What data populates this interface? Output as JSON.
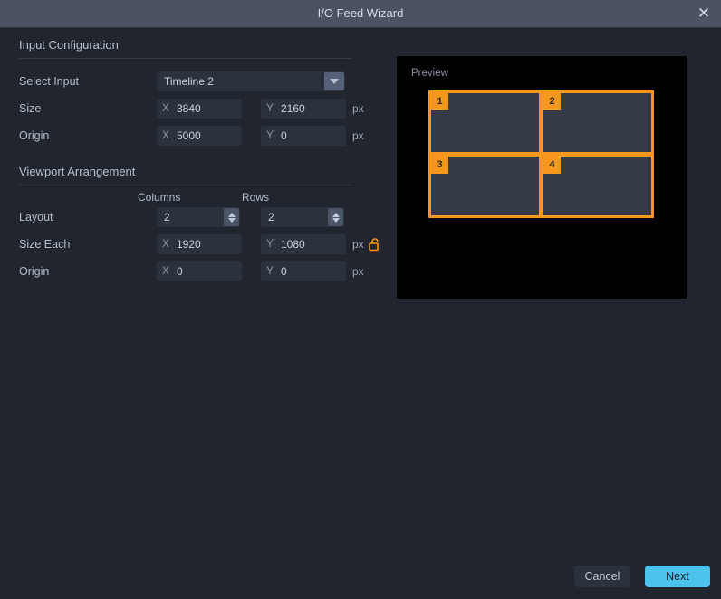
{
  "window": {
    "title": "I/O Feed Wizard",
    "close_icon": "close-icon"
  },
  "input_configuration": {
    "heading": "Input Configuration",
    "select_input": {
      "label": "Select Input",
      "value": "Timeline 2",
      "arrow_icon": "chevron-down-icon"
    },
    "size": {
      "label": "Size",
      "x_axis": "X",
      "x_value": "3840",
      "y_axis": "Y",
      "y_value": "2160",
      "unit": "px"
    },
    "origin": {
      "label": "Origin",
      "x_axis": "X",
      "x_value": "5000",
      "y_axis": "Y",
      "y_value": "0",
      "unit": "px"
    }
  },
  "viewport_arrangement": {
    "heading": "Viewport Arrangement",
    "columns_header": "Columns",
    "rows_header": "Rows",
    "layout": {
      "label": "Layout",
      "columns": "2",
      "rows": "2"
    },
    "size_each": {
      "label": "Size Each",
      "x_axis": "X",
      "x_value": "1920",
      "y_axis": "Y",
      "y_value": "1080",
      "unit": "px",
      "lock_icon": "unlocked-padlock-icon"
    },
    "origin": {
      "label": "Origin",
      "x_axis": "X",
      "x_value": "0",
      "y_axis": "Y",
      "y_value": "0",
      "unit": "px"
    }
  },
  "preview": {
    "label": "Preview",
    "viewports": [
      "1",
      "2",
      "3",
      "4"
    ]
  },
  "footer": {
    "cancel_label": "Cancel",
    "next_label": "Next"
  },
  "colors": {
    "accent_orange": "#f7971d",
    "accent_blue": "#4cc3ec",
    "titlebar": "#4a5264",
    "background": "#21262e"
  }
}
